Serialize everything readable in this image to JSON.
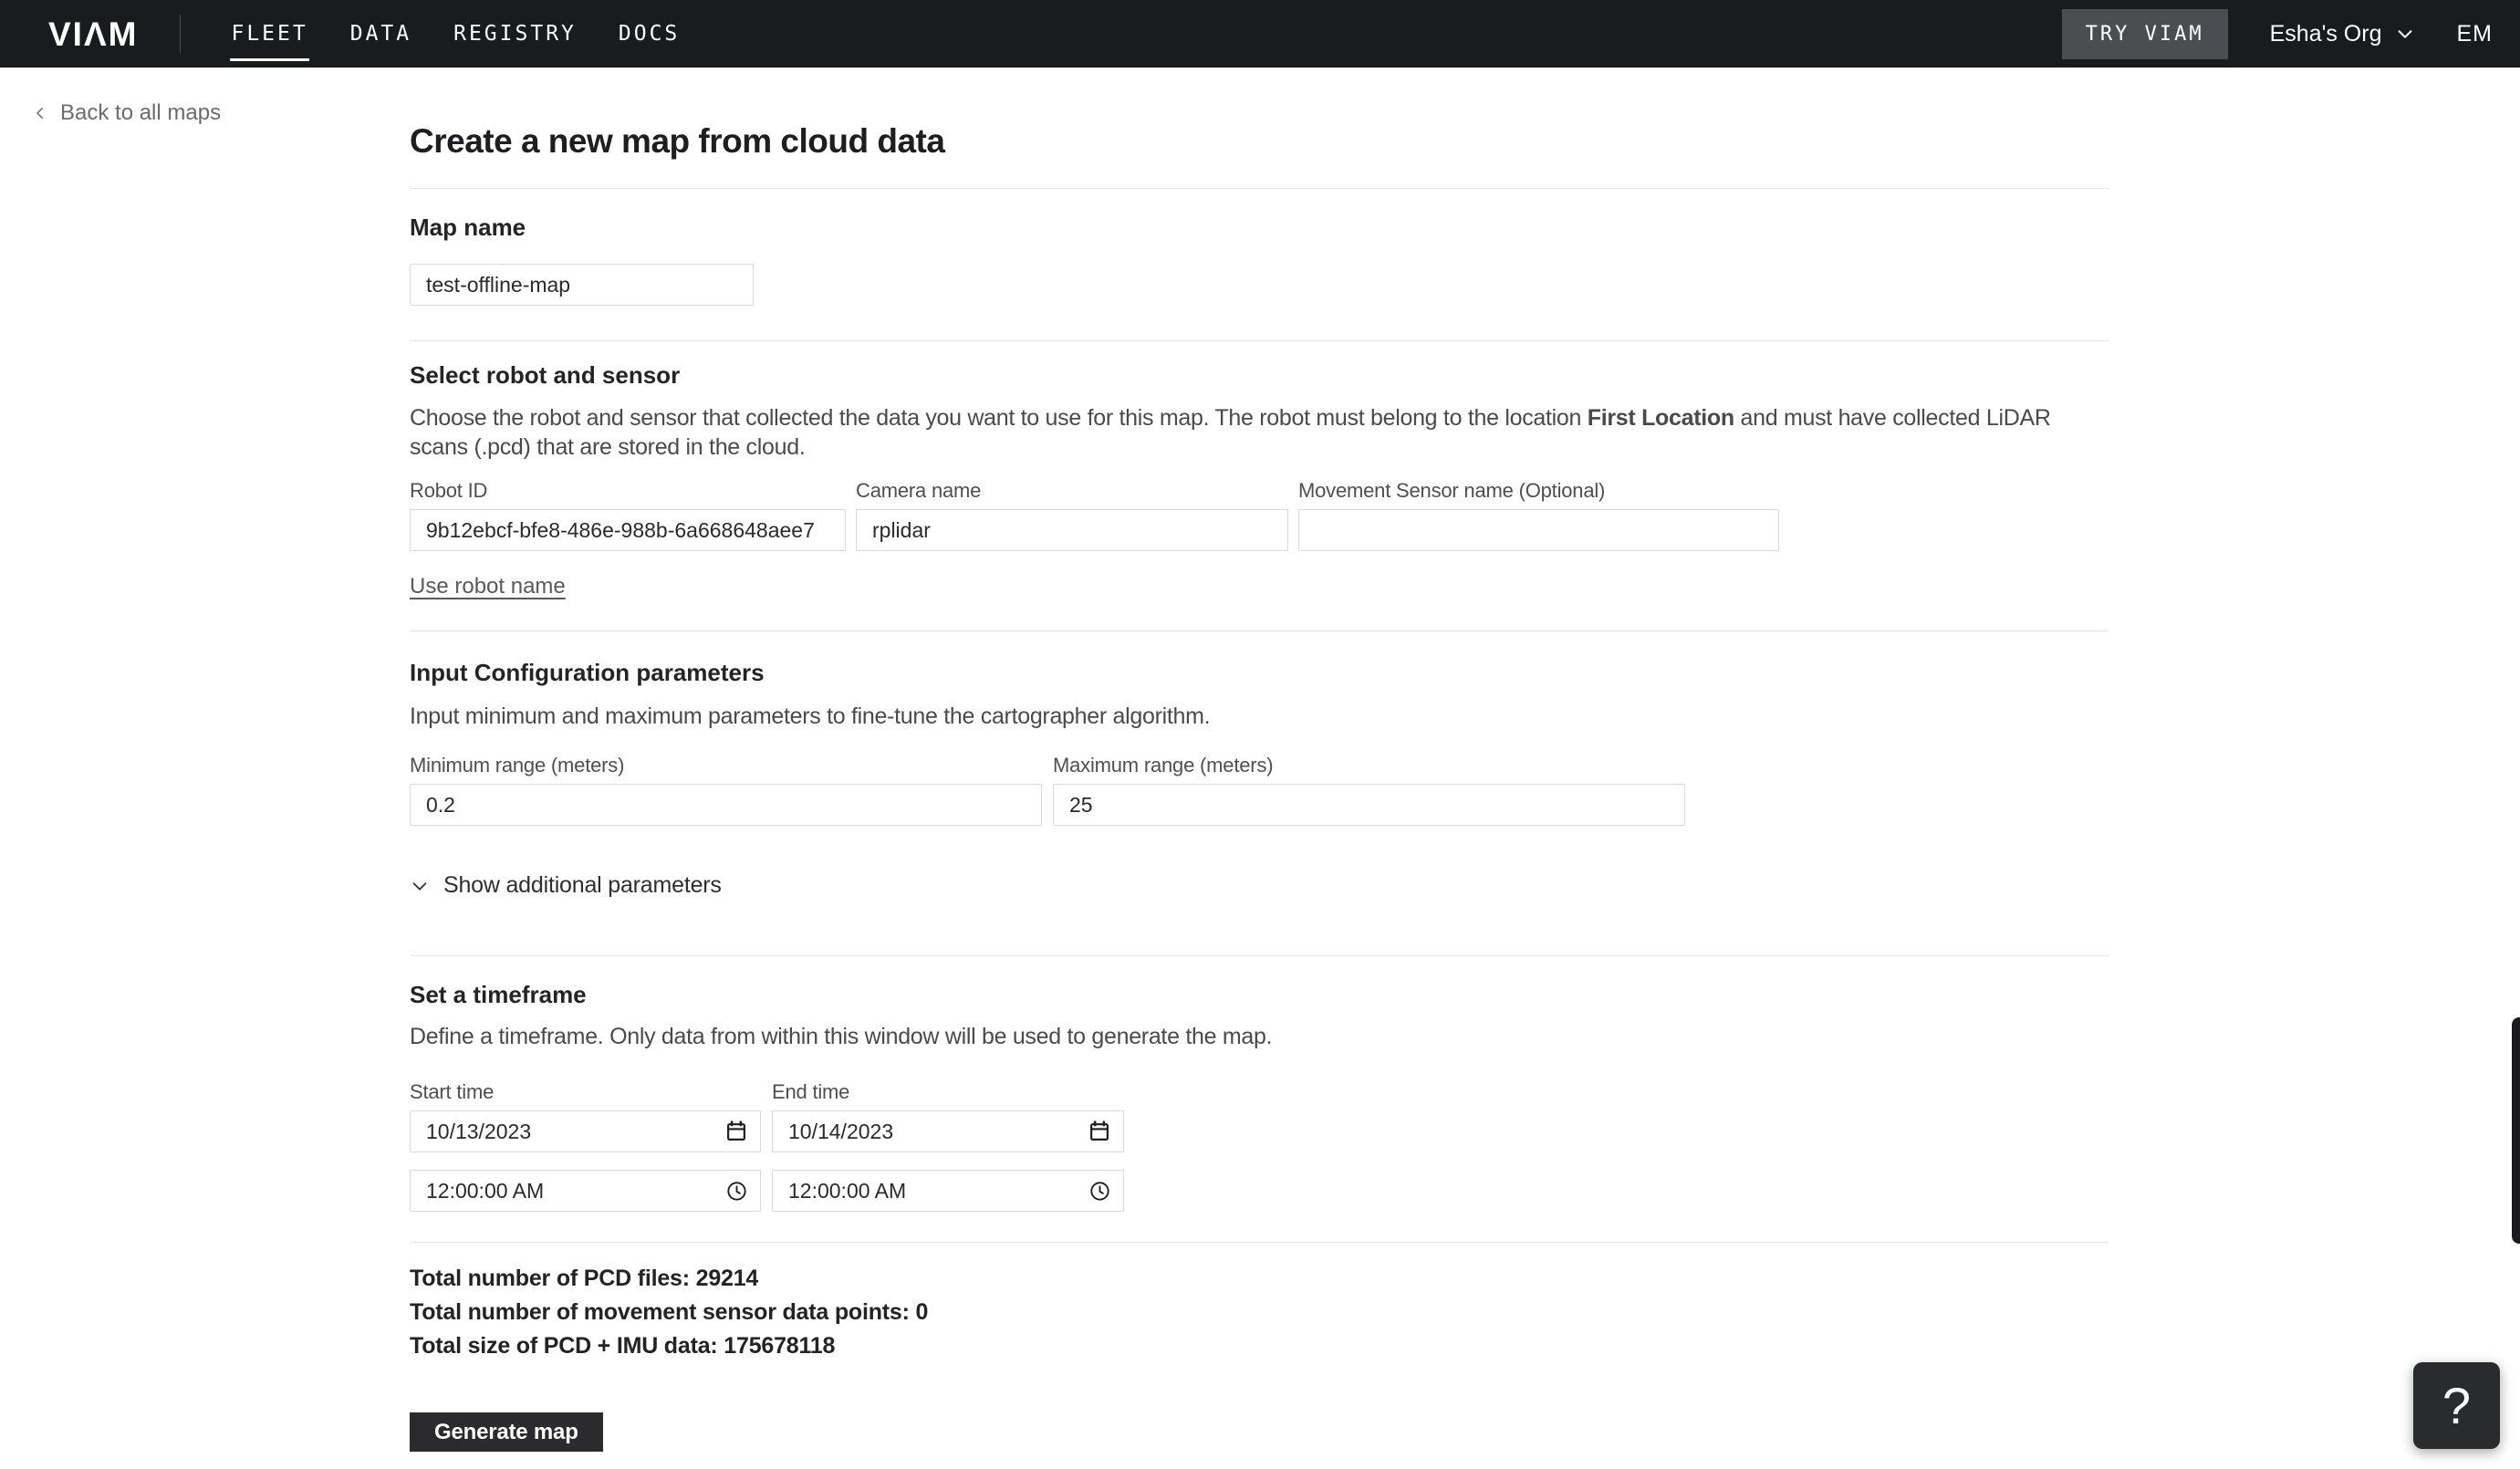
{
  "navbar": {
    "logo": "VIΛM",
    "items": [
      {
        "label": "FLEET",
        "active": true
      },
      {
        "label": "DATA",
        "active": false
      },
      {
        "label": "REGISTRY",
        "active": false
      },
      {
        "label": "DOCS",
        "active": false
      }
    ],
    "try_viam_label": "TRY VIAM",
    "org_name": "Esha's Org",
    "avatar_initials": "EM"
  },
  "back_link_label": "Back to all maps",
  "page_title": "Create a new map from cloud data",
  "map_name": {
    "label": "Map name",
    "value": "test-offline-map"
  },
  "robot_sensor": {
    "heading": "Select robot and sensor",
    "description_before": "Choose the robot and sensor that collected the data you want to use for this map. The robot must belong to the location ",
    "description_bold": "First Location",
    "description_after": " and must have collected LiDAR scans (.pcd) that are stored in the cloud.",
    "robot_id": {
      "label": "Robot ID",
      "value": "9b12ebcf-bfe8-486e-988b-6a668648aee7"
    },
    "camera_name": {
      "label": "Camera name",
      "value": "rplidar"
    },
    "movement_sensor": {
      "label": "Movement Sensor name (Optional)",
      "value": ""
    },
    "use_robot_name_link": "Use robot name"
  },
  "config_params": {
    "heading": "Input Configuration parameters",
    "description": "Input minimum and maximum parameters to fine-tune the cartographer algorithm.",
    "min_range": {
      "label": "Minimum range (meters)",
      "value": "0.2"
    },
    "max_range": {
      "label": "Maximum range (meters)",
      "value": "25"
    },
    "show_additional_label": "Show additional parameters"
  },
  "timeframe": {
    "heading": "Set a timeframe",
    "description": "Define a timeframe. Only data from within this window will be used to generate the map.",
    "start": {
      "label": "Start time",
      "date": "10/13/2023",
      "time": "12:00:00 AM"
    },
    "end": {
      "label": "End time",
      "date": "10/14/2023",
      "time": "12:00:00 AM"
    }
  },
  "summary": {
    "pcd_label": "Total number of PCD files:",
    "pcd_value": "29214",
    "movement_label": "Total number of movement sensor data points:",
    "movement_value": "0",
    "size_label": "Total size of PCD + IMU data:",
    "size_value": "175678118"
  },
  "generate_button_label": "Generate map",
  "help_button_label": "?",
  "colors": {
    "navbar_bg": "#1a1b1c",
    "try_viam_bg": "#4c4d51",
    "primary_button_bg": "#2b2b2d",
    "input_border": "#d9d9d9",
    "divider": "#e4e4e4",
    "secondary_text": "#4a4a4c",
    "link_gray": "#6b6b6d"
  }
}
